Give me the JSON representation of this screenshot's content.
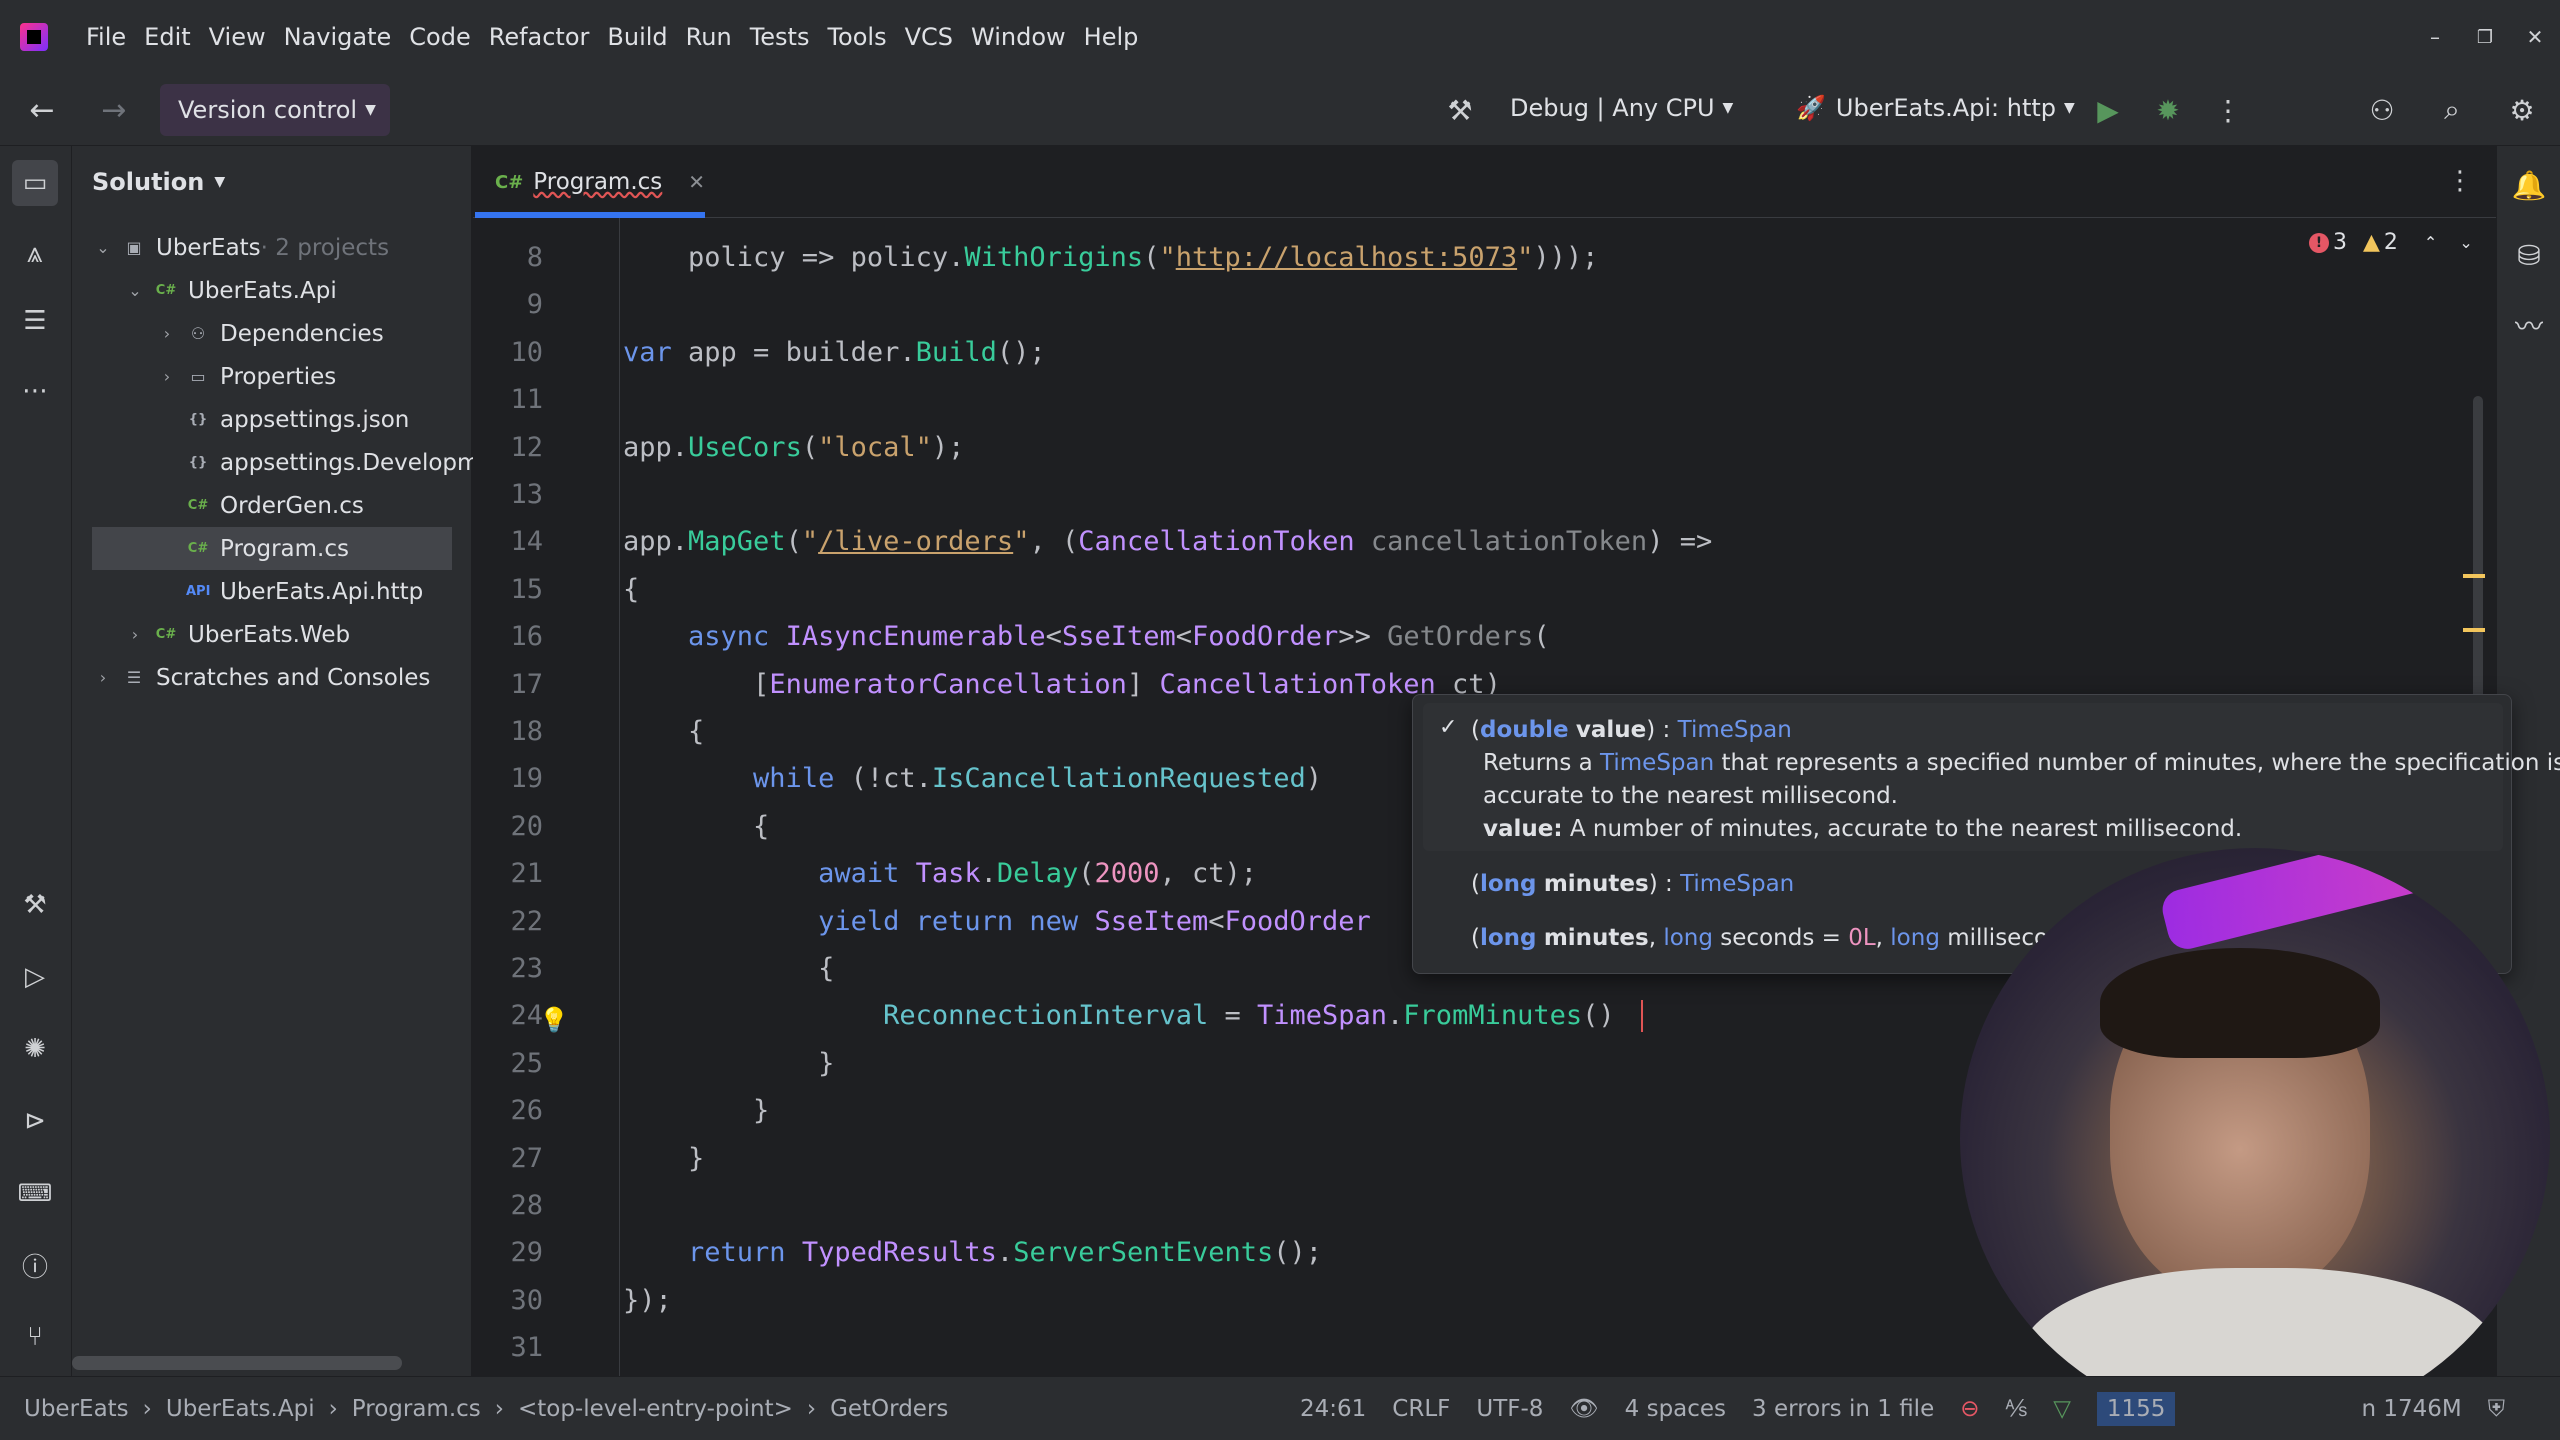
{
  "menu": [
    "File",
    "Edit",
    "View",
    "Navigate",
    "Code",
    "Refactor",
    "Build",
    "Run",
    "Tests",
    "Tools",
    "VCS",
    "Window",
    "Help"
  ],
  "toolbar": {
    "vcs": "Version control",
    "config": "Debug | Any CPU",
    "run_target": "UberEats.Api: http"
  },
  "sidebar": {
    "title": "Solution",
    "items": [
      {
        "label": "UberEats",
        "suffix": " · 2 projects",
        "depth": 0,
        "open": true,
        "icon": "solution"
      },
      {
        "label": "UberEats.Api",
        "depth": 1,
        "open": true,
        "icon": "cs-project"
      },
      {
        "label": "Dependencies",
        "depth": 2,
        "closed": true,
        "icon": "deps"
      },
      {
        "label": "Properties",
        "depth": 2,
        "closed": true,
        "icon": "folder"
      },
      {
        "label": "appsettings.json",
        "depth": 2,
        "icon": "json"
      },
      {
        "label": "appsettings.Developme",
        "depth": 2,
        "icon": "json"
      },
      {
        "label": "OrderGen.cs",
        "depth": 2,
        "icon": "cs"
      },
      {
        "label": "Program.cs",
        "depth": 2,
        "icon": "cs",
        "selected": true
      },
      {
        "label": "UberEats.Api.http",
        "depth": 2,
        "icon": "api"
      },
      {
        "label": "UberEats.Web",
        "depth": 1,
        "closed": true,
        "icon": "cs-project"
      },
      {
        "label": "Scratches and Consoles",
        "depth": 0,
        "closed": true,
        "icon": "scratch"
      }
    ]
  },
  "tab": {
    "badge": "C#",
    "label": "Program.cs"
  },
  "inspections": {
    "errors": "3",
    "warnings": "2"
  },
  "code_lines": [
    {
      "n": "8",
      "html": "    policy => policy.<span class='fn'>WithOrigins</span>(<span class='st'>\"<u>http://localhost:5073</u>\"</span>)));"
    },
    {
      "n": "9",
      "html": ""
    },
    {
      "n": "10",
      "html": "<span class='kw'>var</span> app = builder.<span class='fn'>Build</span>();"
    },
    {
      "n": "11",
      "html": ""
    },
    {
      "n": "12",
      "html": "app.<span class='fn'>UseCors</span>(<span class='st'>\"local\"</span>);"
    },
    {
      "n": "13",
      "html": ""
    },
    {
      "n": "14",
      "html": "app.<span class='fn'>MapGet</span>(<span class='st'>\"<u>/live-orders</u>\"</span>, (<span class='ty'>CancellationToken</span> <span class='pm'>cancellationToken</span>) =>"
    },
    {
      "n": "15",
      "html": "{"
    },
    {
      "n": "16",
      "html": "    <span class='kw'>async</span> <span class='ty'>IAsyncEnumerable</span>&lt;<span class='ty'>SseItem</span>&lt;<span class='ty'>FoodOrder</span>&gt;&gt; <span class='pm'>GetOrders</span>("
    },
    {
      "n": "17",
      "html": "        [<span class='ty'>EnumeratorCancellation</span>] <span class='ty'>CancellationToken</span> ct)"
    },
    {
      "n": "18",
      "html": "    {"
    },
    {
      "n": "19",
      "html": "        <span class='kw'>while</span> (!ct.<span class='pr'>IsCancellationRequested</span>)"
    },
    {
      "n": "20",
      "html": "        {"
    },
    {
      "n": "21",
      "html": "            <span class='kw'>await</span> <span class='ty'>Task</span>.<span class='fn'>Delay</span>(<span class='nm'>2000</span>, ct);"
    },
    {
      "n": "22",
      "html": "            <span class='kw'>yield return new</span> <span class='ty'>SseItem</span>&lt;<span class='ty'>FoodOrder</span>"
    },
    {
      "n": "23",
      "html": "            {"
    },
    {
      "n": "24",
      "html": "                <span class='pr'>ReconnectionInterval</span> = <span class='ty'>TimeSpan</span>.<span class='fn'>FromMinutes</span>()"
    },
    {
      "n": "25",
      "html": "            }"
    },
    {
      "n": "26",
      "html": "        }"
    },
    {
      "n": "27",
      "html": "    }"
    },
    {
      "n": "28",
      "html": ""
    },
    {
      "n": "29",
      "html": "    <span class='kw'>return</span> <span class='ty'>TypedResults</span>.<span class='fn'>ServerSentEvents</span>();"
    },
    {
      "n": "30",
      "html": "});"
    },
    {
      "n": "31",
      "html": ""
    }
  ],
  "popup": {
    "sig1_kw": "double",
    "sig1_param": "value",
    "sig1_ret": "TimeSpan",
    "desc1": "Returns a",
    "desc_type": "TimeSpan",
    "desc2": "that represents a specified number of minutes, where the specification is",
    "desc3": "accurate to the nearest millisecond.",
    "param_label": "value:",
    "param_desc": "A number of minutes, accurate to the nearest millisecond.",
    "sig2_kw": "long",
    "sig2_param": "minutes",
    "sig2_ret": "TimeSpan",
    "sig3_kw": "long",
    "sig3_param": "minutes",
    "sig3_kw2": "long",
    "sig3_p2": "seconds = ",
    "sig3_v2": "0L",
    "sig3_kw3": "long",
    "sig3_p3": "milliseconds"
  },
  "breadcrumbs": [
    "UberEats",
    "UberEats.Api",
    "Program.cs",
    "<top-level-entry-point>",
    "GetOrders"
  ],
  "status": {
    "pos": "24:61",
    "eol": "CRLF",
    "enc": "UTF-8",
    "indent": "4 spaces",
    "errors": "3 errors in 1 file",
    "mem": "1155",
    "memtail": "n 1746M"
  }
}
